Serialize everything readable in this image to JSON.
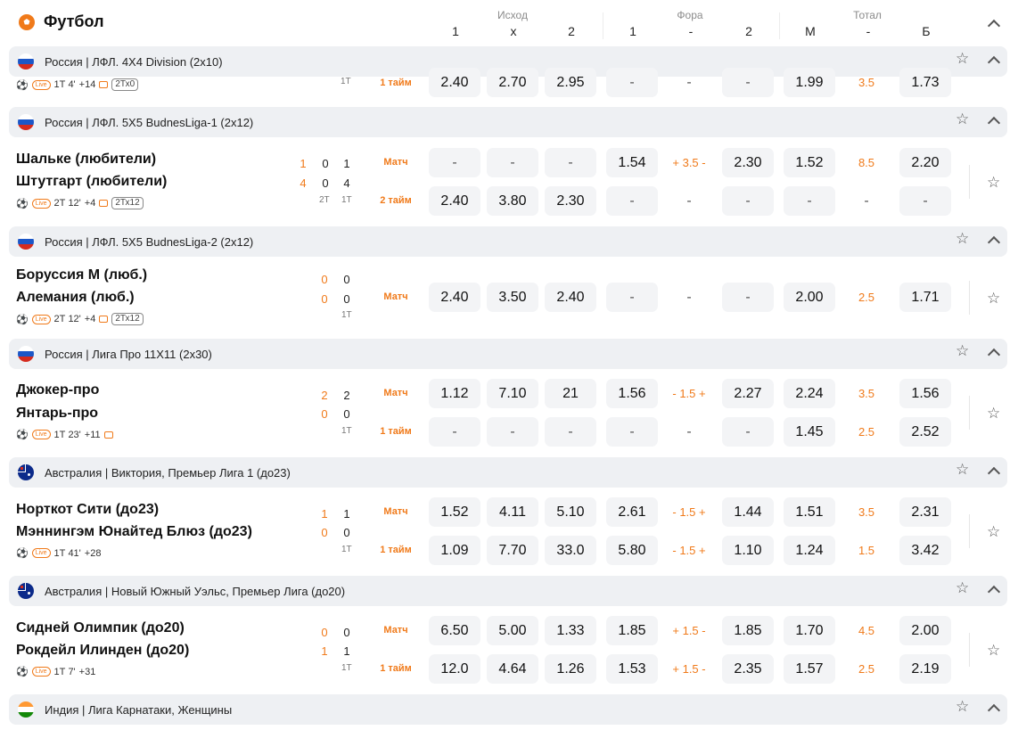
{
  "header": {
    "sport_title": "Футбол",
    "groups": [
      "Исход",
      "Фора",
      "Тотал"
    ],
    "columns": [
      "1",
      "х",
      "2",
      "1",
      "-",
      "2",
      "М",
      "-",
      "Б"
    ]
  },
  "colors": {
    "accent": "#f07a1a",
    "row_bg": "#f3f4f6",
    "league_bg": "#eef0f3"
  },
  "leagues": [
    {
      "country": "Россия",
      "flag": "russia-flag-icon",
      "name": "Россия | ЛФЛ. 4X4 Division (2x10)"
    },
    {
      "country": "Россия",
      "flag": "russia-flag-icon",
      "name": "Россия | ЛФЛ. 5X5 BudnesLiga-1 (2x12)"
    },
    {
      "country": "Россия",
      "flag": "russia-flag-icon",
      "name": "Россия | ЛФЛ. 5X5 BudnesLiga-2 (2x12)"
    },
    {
      "country": "Россия",
      "flag": "russia-flag-icon",
      "name": "Россия | Лига Про 11X11 (2x30)"
    },
    {
      "country": "Австралия",
      "flag": "australia-flag-icon",
      "name": "Австралия | Виктория, Премьер Лига 1 (до23)"
    },
    {
      "country": "Австралия",
      "flag": "australia-flag-icon",
      "name": "Австралия | Новый Южный Уэльс, Премьер Лига (до20)"
    },
    {
      "country": "Индия",
      "flag": "india-flag-icon",
      "name": "Индия | Лига Карнатаки, Женщины"
    }
  ],
  "matches": [
    {
      "teams": [],
      "scores": [],
      "period_label": "1Т",
      "meta": {
        "time": "1Т 4'",
        "more": "+14",
        "box": "2Тх0"
      },
      "lines": [
        {
          "label": "1 тайм",
          "odds": [
            "2.40",
            "2.70",
            "2.95",
            "-",
            "-",
            "-",
            "1.99",
            "3.5",
            "1.73"
          ]
        }
      ]
    },
    {
      "teams": [
        "Шальке (любители)",
        "Штутгарт (любители)"
      ],
      "scores": [
        [
          "1",
          "0",
          "1"
        ],
        [
          "4",
          "0",
          "4"
        ]
      ],
      "period_labels": [
        "2Т",
        "1Т"
      ],
      "meta": {
        "time": "2Т 12'",
        "more": "+4",
        "box": "2Тх12"
      },
      "lines": [
        {
          "label": "Матч",
          "odds": [
            "-",
            "-",
            "-",
            "1.54",
            "+ 3.5 -",
            "2.30",
            "1.52",
            "8.5",
            "2.20"
          ]
        },
        {
          "label": "2 тайм",
          "odds": [
            "2.40",
            "3.80",
            "2.30",
            "-",
            "-",
            "-",
            "-",
            "-",
            "-"
          ]
        }
      ]
    },
    {
      "teams": [
        "Боруссия М (люб.)",
        "Алемания (люб.)"
      ],
      "scores": [
        [
          "0",
          "0"
        ],
        [
          "0",
          "0"
        ]
      ],
      "period_label": "1Т",
      "meta": {
        "time": "2Т 12'",
        "more": "+4",
        "box": "2Тх12"
      },
      "lines": [
        {
          "label": "Матч",
          "odds": [
            "2.40",
            "3.50",
            "2.40",
            "-",
            "-",
            "-",
            "2.00",
            "2.5",
            "1.71"
          ]
        }
      ]
    },
    {
      "teams": [
        "Джокер-про",
        "Янтарь-про"
      ],
      "scores": [
        [
          "2",
          "2"
        ],
        [
          "0",
          "0"
        ]
      ],
      "period_label": "1Т",
      "meta": {
        "time": "1Т 23'",
        "more": "+11"
      },
      "lines": [
        {
          "label": "Матч",
          "odds": [
            "1.12",
            "7.10",
            "21",
            "1.56",
            "- 1.5 +",
            "2.27",
            "2.24",
            "3.5",
            "1.56"
          ]
        },
        {
          "label": "1 тайм",
          "odds": [
            "-",
            "-",
            "-",
            "-",
            "-",
            "-",
            "1.45",
            "2.5",
            "2.52"
          ]
        }
      ]
    },
    {
      "teams": [
        "Норткот Сити (до23)",
        "Мэннингэм Юнайтед Блюз (до23)"
      ],
      "scores": [
        [
          "1",
          "1"
        ],
        [
          "0",
          "0"
        ]
      ],
      "period_label": "1Т",
      "meta": {
        "time": "1Т 41'",
        "more": "+28"
      },
      "lines": [
        {
          "label": "Матч",
          "odds": [
            "1.52",
            "4.11",
            "5.10",
            "2.61",
            "- 1.5 +",
            "1.44",
            "1.51",
            "3.5",
            "2.31"
          ]
        },
        {
          "label": "1 тайм",
          "odds": [
            "1.09",
            "7.70",
            "33.0",
            "5.80",
            "- 1.5 +",
            "1.10",
            "1.24",
            "1.5",
            "3.42"
          ]
        }
      ]
    },
    {
      "teams": [
        "Сидней Олимпик (до20)",
        "Рокдейл Илинден (до20)"
      ],
      "scores": [
        [
          "0",
          "0"
        ],
        [
          "1",
          "1"
        ]
      ],
      "period_label": "1Т",
      "meta": {
        "time": "1Т 7'",
        "more": "+31"
      },
      "lines": [
        {
          "label": "Матч",
          "odds": [
            "6.50",
            "5.00",
            "1.33",
            "1.85",
            "+ 1.5 -",
            "1.85",
            "1.70",
            "4.5",
            "2.00"
          ]
        },
        {
          "label": "1 тайм",
          "odds": [
            "12.0",
            "4.64",
            "1.26",
            "1.53",
            "+ 1.5 -",
            "2.35",
            "1.57",
            "2.5",
            "2.19"
          ]
        }
      ]
    }
  ]
}
